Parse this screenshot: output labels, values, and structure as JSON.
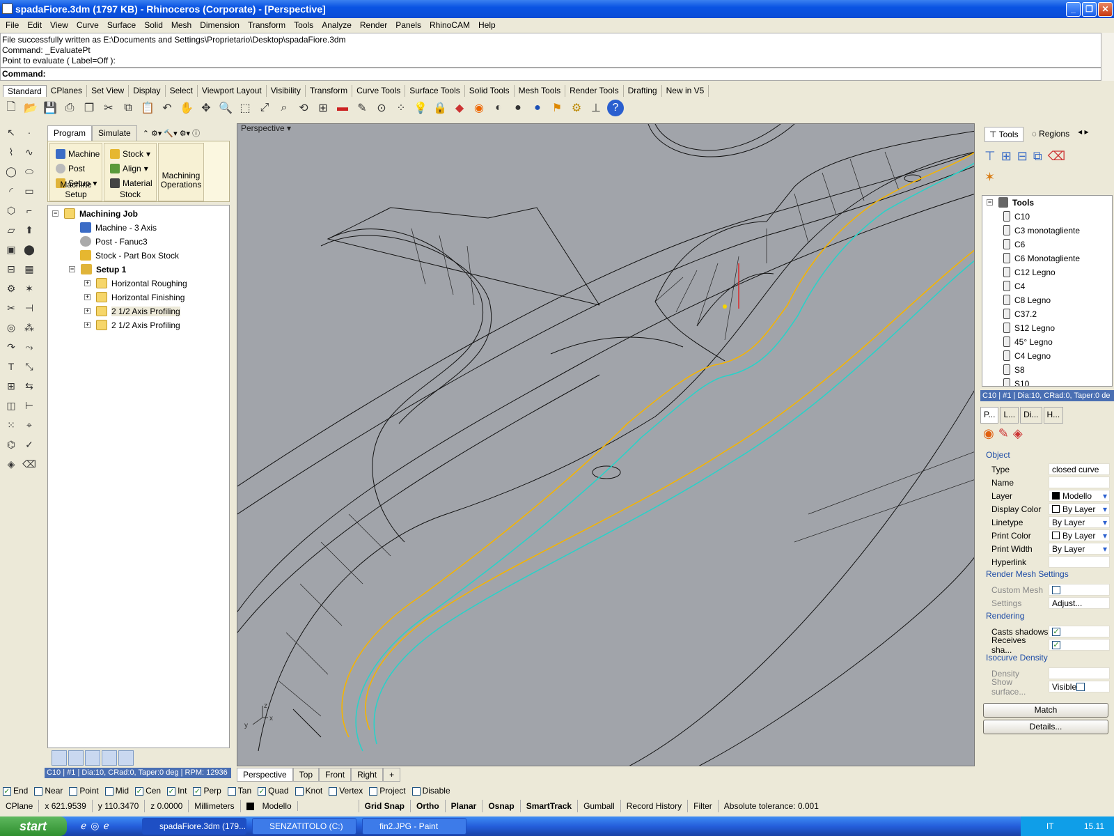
{
  "window": {
    "title": "spadaFiore.3dm (1797 KB) - Rhinoceros (Corporate) - [Perspective]"
  },
  "menu": [
    "File",
    "Edit",
    "View",
    "Curve",
    "Surface",
    "Solid",
    "Mesh",
    "Dimension",
    "Transform",
    "Tools",
    "Analyze",
    "Render",
    "Panels",
    "RhinoCAM",
    "Help"
  ],
  "command": {
    "lines": [
      "File successfully written as E:\\Documents and Settings\\Proprietario\\Desktop\\spadaFiore.3dm",
      "Command: _EvaluatePt",
      "Point to evaluate ( Label=Off ):"
    ],
    "prompt": "Command:"
  },
  "toolbar_tabs": [
    "Standard",
    "CPlanes",
    "Set View",
    "Display",
    "Select",
    "Viewport Layout",
    "Visibility",
    "Transform",
    "Curve Tools",
    "Surface Tools",
    "Solid Tools",
    "Mesh Tools",
    "Render Tools",
    "Drafting",
    "New in V5"
  ],
  "cam": {
    "tabs": [
      "Program",
      "Simulate"
    ],
    "ribbon": {
      "machine": "Machine",
      "post": "Post",
      "setup": "Setup",
      "machine_setup": "Machine Setup",
      "stock": "Stock",
      "align": "Align",
      "material": "Material",
      "stock_group": "Stock",
      "machining_ops": "Machining Operations"
    },
    "tree": {
      "root": "Machining Job",
      "machine": "Machine - 3 Axis",
      "post": "Post - Fanuc3",
      "stock": "Stock - Part Box Stock",
      "setup": "Setup 1",
      "ops": [
        "Horizontal Roughing",
        "Horizontal Finishing",
        "2 1/2 Axis Profiling",
        "2 1/2 Axis Profiling"
      ]
    },
    "status": "C10 | #1 | Dia:10, CRad:0, Taper:0 deg | RPM: 12936"
  },
  "viewport": {
    "label": "Perspective",
    "tabs": [
      "Perspective",
      "Top",
      "Front",
      "Right"
    ],
    "axis": {
      "x": "x",
      "y": "y",
      "z": "z"
    }
  },
  "right": {
    "tabs": [
      "Tools",
      "Regions"
    ],
    "tree_root": "Tools",
    "tools": [
      "C10",
      "C3 monotagliente",
      "C6",
      "C6 Monotagliente",
      "C12 Legno",
      "C4",
      "C8 Legno",
      "C37.2",
      "S12 Legno",
      "45° Legno",
      "C4 Legno",
      "S8",
      "S10"
    ],
    "status": "C10 | #1 | Dia:10, CRad:0, Taper:0 de",
    "prop_tabs": [
      "P...",
      "L...",
      "Di...",
      "H..."
    ],
    "object_section": "Object",
    "props": [
      {
        "k": "Type",
        "v": "closed curve"
      },
      {
        "k": "Name",
        "v": ""
      },
      {
        "k": "Layer",
        "v": "Modello"
      },
      {
        "k": "Display Color",
        "v": "By Layer"
      },
      {
        "k": "Linetype",
        "v": "By Layer"
      },
      {
        "k": "Print Color",
        "v": "By Layer"
      },
      {
        "k": "Print Width",
        "v": "By Layer"
      },
      {
        "k": "Hyperlink",
        "v": ""
      }
    ],
    "render_mesh": {
      "title": "Render Mesh Settings",
      "custom": "Custom Mesh",
      "settings": "Settings",
      "adjust": "Adjust..."
    },
    "rendering": {
      "title": "Rendering",
      "casts": "Casts shadows",
      "receives": "Receives sha..."
    },
    "isocurve": {
      "title": "Isocurve Density",
      "density": "Density",
      "show": "Show surface...",
      "visible": "Visible"
    },
    "match": "Match",
    "details": "Details..."
  },
  "osnaps": [
    {
      "label": "End",
      "on": true
    },
    {
      "label": "Near",
      "on": false
    },
    {
      "label": "Point",
      "on": false
    },
    {
      "label": "Mid",
      "on": false
    },
    {
      "label": "Cen",
      "on": true
    },
    {
      "label": "Int",
      "on": true
    },
    {
      "label": "Perp",
      "on": true
    },
    {
      "label": "Tan",
      "on": false
    },
    {
      "label": "Quad",
      "on": true
    },
    {
      "label": "Knot",
      "on": false
    },
    {
      "label": "Vertex",
      "on": false
    },
    {
      "label": "Project",
      "on": false
    },
    {
      "label": "Disable",
      "on": false
    }
  ],
  "status": {
    "cplane": "CPlane",
    "x": "x 621.9539",
    "y": "y 110.3470",
    "z": "z 0.0000",
    "units": "Millimeters",
    "layer": "Modello",
    "grid": "Grid Snap",
    "ortho": "Ortho",
    "planar": "Planar",
    "osnap": "Osnap",
    "smarttrack": "SmartTrack",
    "gumball": "Gumball",
    "record": "Record History",
    "filter": "Filter",
    "tolerance": "Absolute tolerance: 0.001"
  },
  "taskbar": {
    "start": "start",
    "tasks": [
      "spadaFiore.3dm (179...",
      "SENZATITOLO (C:)",
      "fin2.JPG - Paint"
    ],
    "lang": "IT",
    "clock": "15.11"
  },
  "colors": {
    "viewport_bg": "#a1a4aa",
    "curve_yellow": "#f5b400",
    "curve_cyan": "#2bd1c8",
    "status_blue": "#4a6fb3"
  }
}
